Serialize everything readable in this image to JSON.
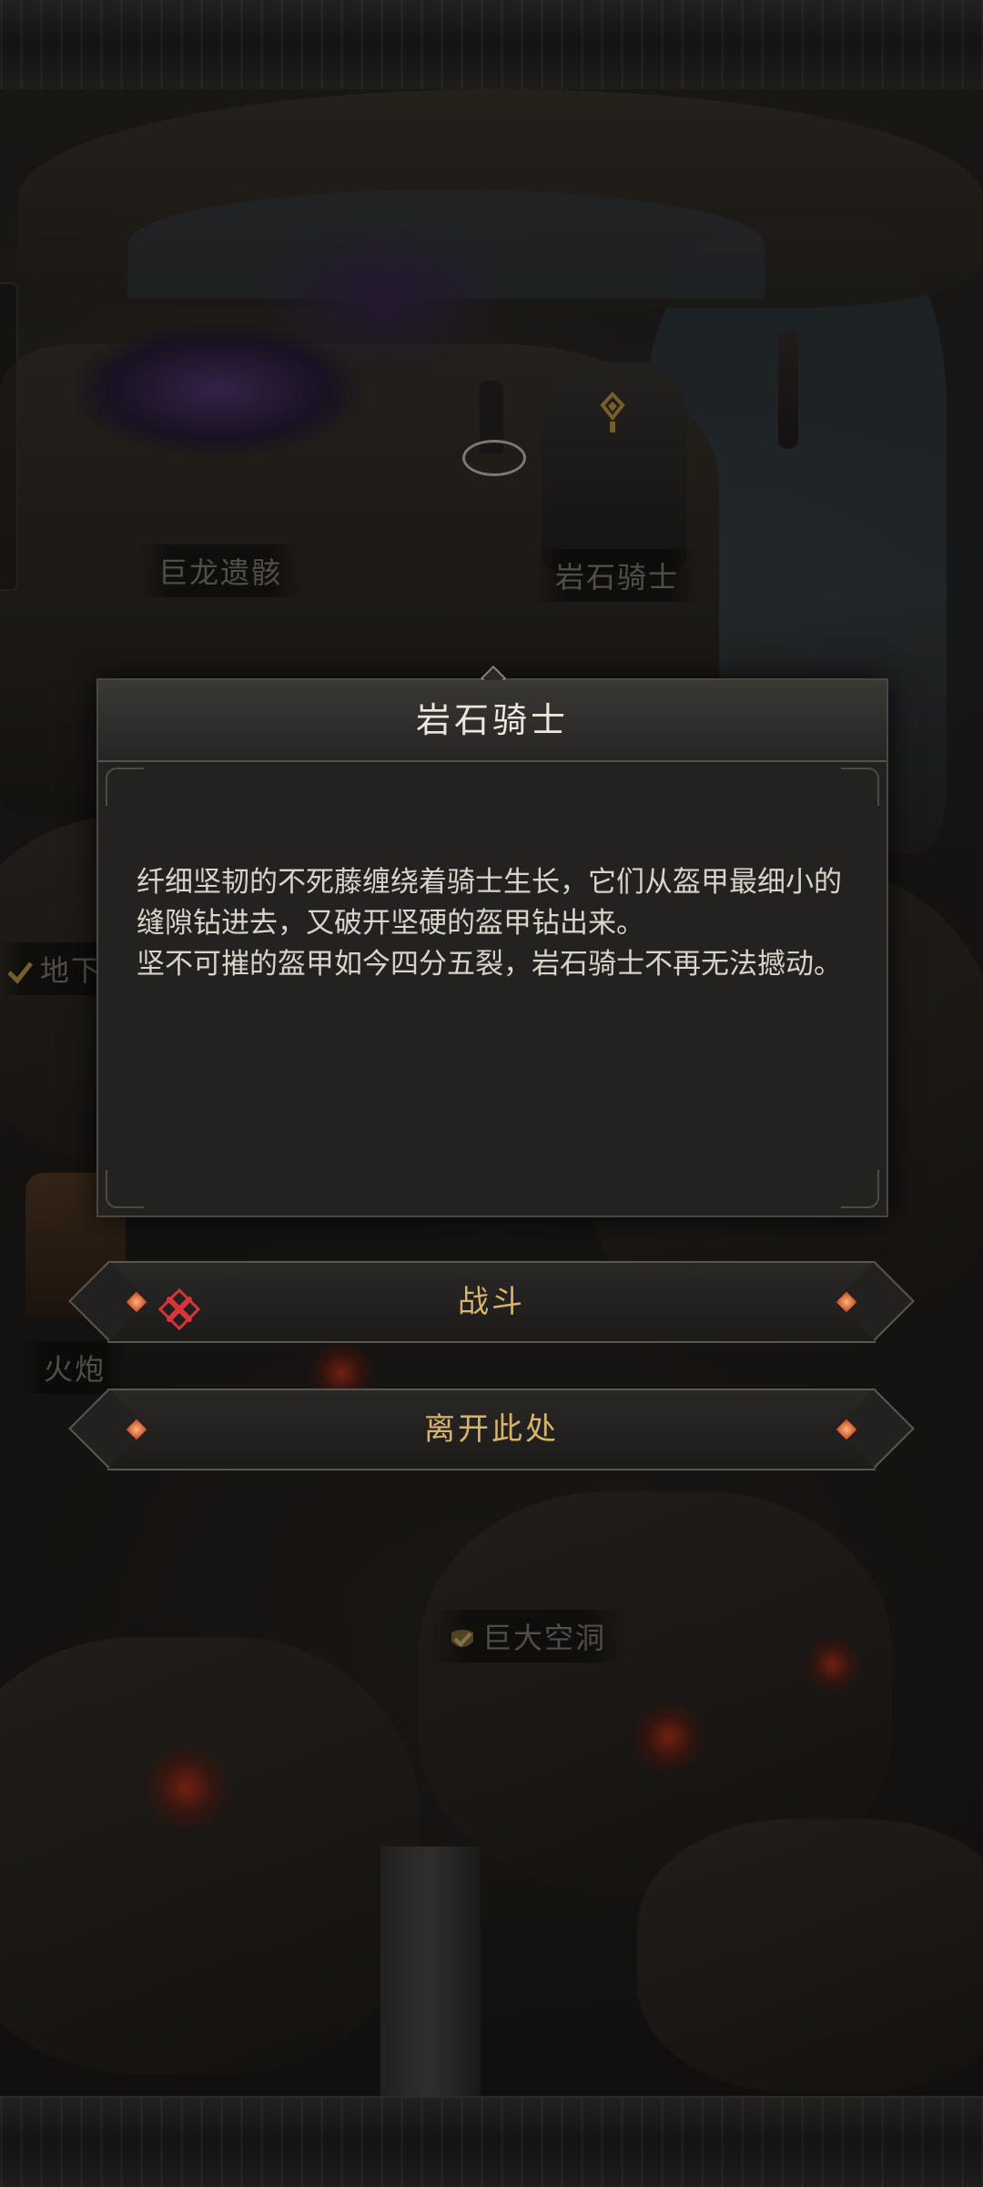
{
  "map": {
    "labels": {
      "dragon_remains": "巨龙遗骸",
      "rock_knight": "岩石骑士",
      "underground": "地下",
      "cannon": "火炮",
      "giant_cave": "巨大空洞"
    }
  },
  "dialog": {
    "title": "岩石骑士",
    "paragraphs": [
      "纤细坚韧的不死藤缠绕着骑士生长，它们从盔甲最细小的缝隙钻进去，又破开坚硬的盔甲钻出来。",
      "坚不可摧的盔甲如今四分五裂，岩石骑士不再无法撼动。"
    ]
  },
  "options": {
    "fight_label": "战斗",
    "leave_label": "离开此处"
  },
  "colors": {
    "accent_gold": "#d7b46a",
    "warning_red": "#d6353a",
    "panel": "#232221"
  },
  "icons": [
    "marker-icon",
    "check-icon",
    "crossed-swords-icon",
    "gem-icon"
  ]
}
